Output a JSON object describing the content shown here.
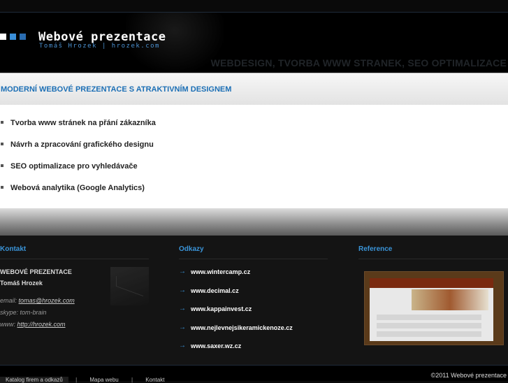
{
  "header": {
    "logo_title": "Webové prezentace",
    "logo_subtitle": "Tomáš Hrozek | hrozek.com",
    "tagline": "WEBDESIGN, TVORBA WWW STRANEK, SEO OPTIMALIZACE",
    "colors": {
      "accent": "#3a8fd9",
      "square_white": "#ffffff"
    }
  },
  "main": {
    "heading": "MODERNÍ WEBOVÉ PREZENTACE S ATRAKTIVNÍM DESIGNEM",
    "services": [
      "Tvorba www stránek na přání zákazníka",
      "Návrh a zpracování grafického designu",
      "SEO optimalizace pro vyhledávače",
      "Webová analytika (Google Analytics)"
    ]
  },
  "footer": {
    "contact": {
      "heading": "Kontakt",
      "org": "WEBOVÉ PREZENTACE",
      "name": "Tomáš Hrozek",
      "email_label": "email:",
      "email": "tomas@hrozek.com",
      "skype_label": "skype:",
      "skype": "tom-brain",
      "www_label": "www:",
      "www": "http://hrozek.com"
    },
    "links": {
      "heading": "Odkazy",
      "items": [
        "www.wintercamp.cz",
        "www.decimal.cz",
        "www.kappainvest.cz",
        "www.nejlevnejsikeramickenoze.cz",
        "www.saxer.wz.cz"
      ]
    },
    "reference": {
      "heading": "Reference"
    }
  },
  "bottom": {
    "nav": [
      "Katalog firem a odkazů",
      "Mapa webu",
      "Kontakt"
    ],
    "separator": "|",
    "copyright": "©2011 Webové prezentace"
  }
}
